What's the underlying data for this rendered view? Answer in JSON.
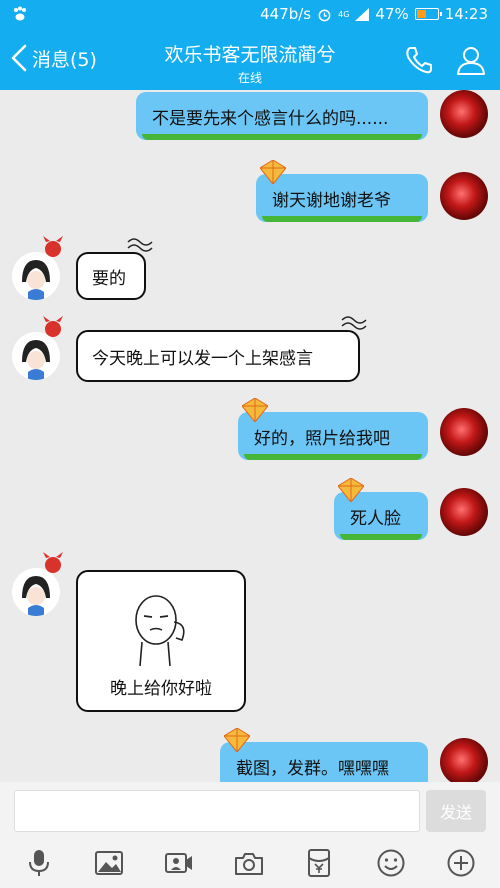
{
  "status": {
    "net_speed": "447b/s",
    "signal": "4G",
    "battery": "47%",
    "battery_level": 0.47,
    "time": "14:23"
  },
  "header": {
    "back_label": "消息(5)",
    "title": "欢乐书客无限流蔺兮",
    "subtitle": "在线"
  },
  "messages": [
    {
      "side": "me",
      "text": "不是要先来个感言什么的吗......"
    },
    {
      "side": "me",
      "text": "谢天谢地谢老爷"
    },
    {
      "side": "other",
      "text": "要的"
    },
    {
      "side": "other",
      "text": "今天晚上可以发一个上架感言"
    },
    {
      "side": "me",
      "text": "好的，照片给我吧"
    },
    {
      "side": "me",
      "text": "死人脸"
    },
    {
      "side": "other",
      "text": "晚上给你好啦",
      "has_meme": true
    },
    {
      "side": "me",
      "text": "截图，发群。嘿嘿嘿"
    }
  ],
  "input": {
    "value": "",
    "send_label": "发送"
  },
  "toolbar": [
    "mic-icon",
    "image-icon",
    "video-icon",
    "camera-icon",
    "red-packet-icon",
    "emoji-icon",
    "plus-icon"
  ],
  "colors": {
    "accent": "#14aef0",
    "my_bubble": "#6bc6f5",
    "bubble_grass": "#45b638"
  }
}
